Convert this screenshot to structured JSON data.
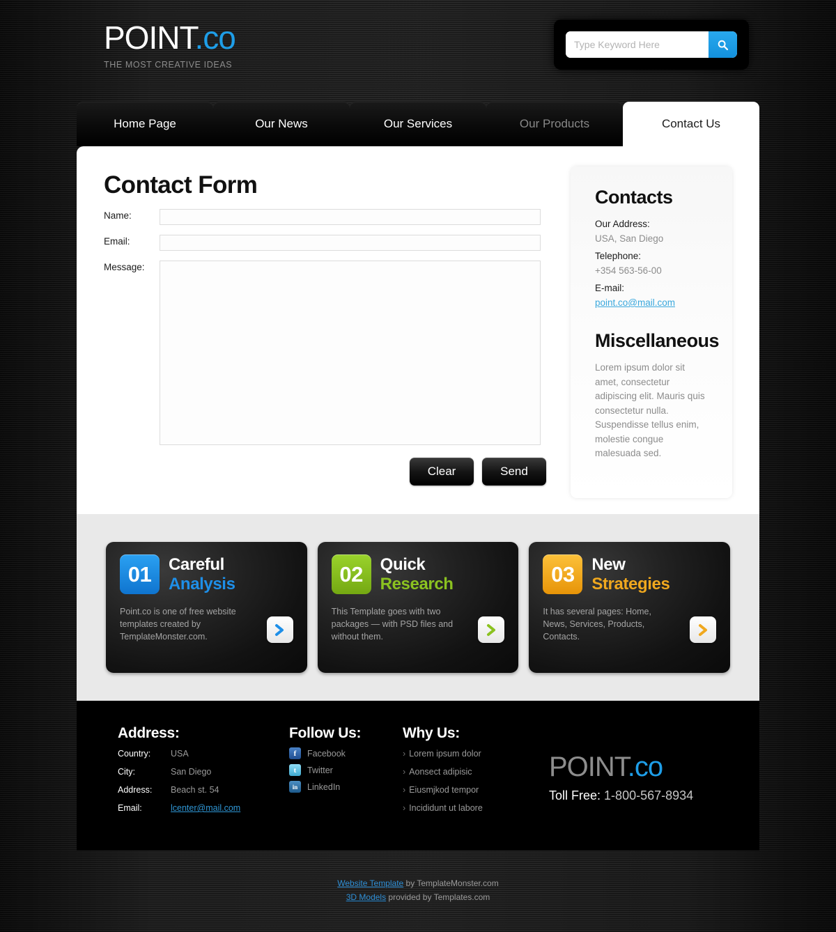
{
  "header": {
    "logo_main": "POINT",
    "logo_accent": ".co",
    "tagline": "THE MOST CREATIVE IDEAS",
    "search": {
      "placeholder": "Type Keyword Here",
      "value": "",
      "icon": "search-icon",
      "button_color": "#1e9ee8"
    }
  },
  "nav": {
    "items": [
      {
        "label": "Home Page",
        "active": false
      },
      {
        "label": "Our News",
        "active": false
      },
      {
        "label": "Our Services",
        "active": false
      },
      {
        "label": "Our Products",
        "active": false
      },
      {
        "label": "Contact Us",
        "active": true
      }
    ]
  },
  "main": {
    "title": "Contact Form",
    "fields": [
      {
        "label": "Name:",
        "value": "",
        "type": "text"
      },
      {
        "label": "Email:",
        "value": "",
        "type": "text"
      },
      {
        "label": "Message:",
        "value": "",
        "type": "textarea"
      }
    ],
    "buttons": {
      "clear": "Clear",
      "send": "Send"
    }
  },
  "sidebar": {
    "contacts_heading": "Contacts",
    "contacts": [
      {
        "term": "Our Address:",
        "value": "USA, San Diego",
        "is_link": false
      },
      {
        "term": "Telephone:",
        "value": "+354 563-56-00",
        "is_link": false
      },
      {
        "term": "E-mail:",
        "value": "point.co@mail.com",
        "is_link": true
      }
    ],
    "misc_heading": "Miscellaneous",
    "misc_text": "Lorem ipsum dolor sit amet, consectetur adipiscing elit. Mauris quis consectetur nulla. Suspendisse tellus enim, molestie congue malesuada sed."
  },
  "cards": [
    {
      "number": "01",
      "title_line1": "Careful",
      "title_line2": "Analysis",
      "description": "Point.co is one of free website templates created by TemplateMonster.com.",
      "color": "#1e8fe8",
      "arrow_icon": "chevron-right-icon"
    },
    {
      "number": "02",
      "title_line1": "Quick",
      "title_line2": "Research",
      "description": "This Template goes with two packages — with PSD files and without them.",
      "color": "#8bc220",
      "arrow_icon": "chevron-right-icon"
    },
    {
      "number": "03",
      "title_line1": "New",
      "title_line2": "Strategies",
      "description": "It has several pages: Home, News, Services, Products, Contacts.",
      "color": "#f0a81e",
      "arrow_icon": "chevron-right-icon"
    }
  ],
  "footer": {
    "address_heading": "Address:",
    "address_rows": [
      {
        "key": "Country:",
        "value": "USA",
        "is_link": false
      },
      {
        "key": "City:",
        "value": "San Diego",
        "is_link": false
      },
      {
        "key": "Address:",
        "value": "Beach st. 54",
        "is_link": false
      },
      {
        "key": "Email:",
        "value": "lcenter@mail.com",
        "is_link": true
      }
    ],
    "follow_heading": "Follow Us:",
    "socials": [
      {
        "label": "Facebook",
        "icon": "facebook-icon",
        "glyph": "f",
        "color": "#2b5fa5"
      },
      {
        "label": "Twitter",
        "icon": "twitter-icon",
        "glyph": "t",
        "color": "#56c5e8"
      },
      {
        "label": "LinkedIn",
        "icon": "linkedin-icon",
        "glyph": "in",
        "color": "#2d6fa8"
      }
    ],
    "why_heading": "Why Us:",
    "why_items": [
      "Lorem ipsum dolor",
      "Aonsect adipisic",
      "Eiusmjkod tempor",
      "Incididunt ut labore"
    ],
    "logo_main": "POINT",
    "logo_accent": ".co",
    "toll_label": "Toll Free:",
    "toll_number": "1-800-567-8934"
  },
  "credits": {
    "line1_link": "Website Template",
    "line1_rest": " by TemplateMonster.com",
    "line2_link": "3D Models",
    "line2_rest": " provided by Templates.com"
  }
}
